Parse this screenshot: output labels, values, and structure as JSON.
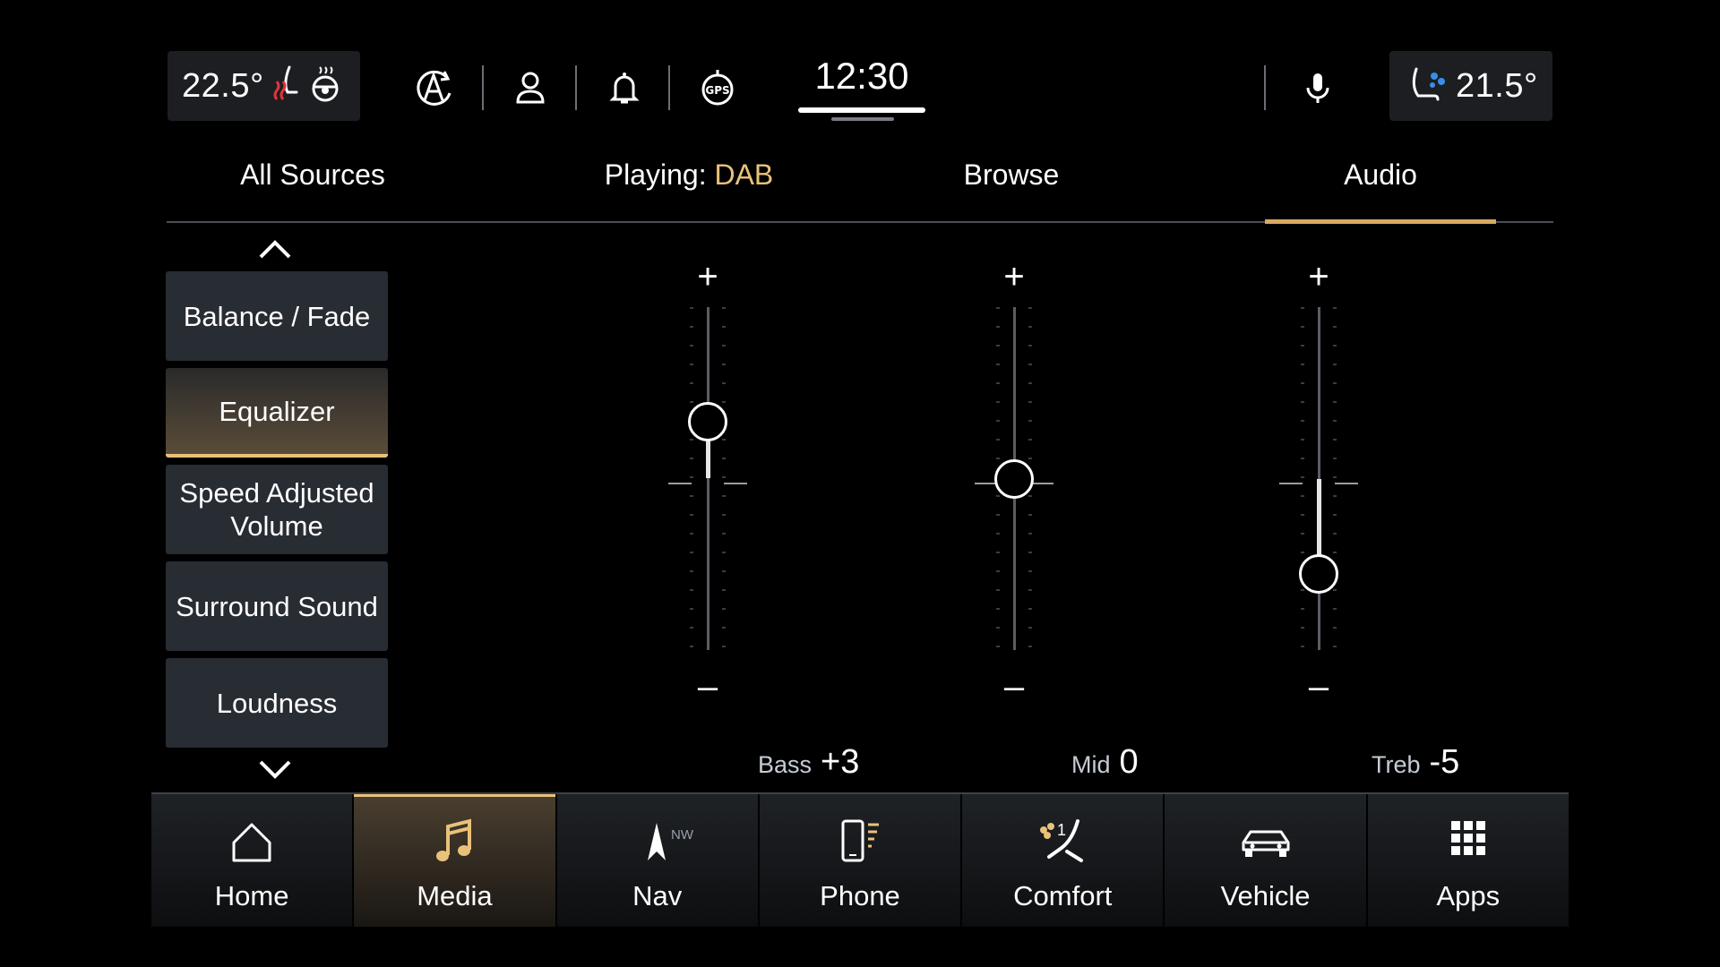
{
  "status": {
    "left_temp": "22.5°",
    "right_temp": "21.5°",
    "clock": "12:30"
  },
  "tabs": [
    {
      "label": "All Sources"
    },
    {
      "label_prefix": "Playing: ",
      "label_source": "DAB"
    },
    {
      "label": "Browse"
    },
    {
      "label": "Audio",
      "active": true
    }
  ],
  "menu": {
    "items": [
      {
        "label": "Balance / Fade"
      },
      {
        "label": "Equalizer",
        "active": true
      },
      {
        "label": "Speed Adjusted Volume"
      },
      {
        "label": "Surround Sound"
      },
      {
        "label": "Loudness"
      }
    ]
  },
  "equalizer": {
    "range": [
      -9,
      9
    ],
    "plus_symbol": "+",
    "minus_symbol": "–",
    "bands": [
      {
        "name": "Bass",
        "value_text": "+3",
        "value": 3
      },
      {
        "name": "Mid",
        "value_text": "0",
        "value": 0
      },
      {
        "name": "Treb",
        "value_text": "-5",
        "value": -5
      }
    ]
  },
  "nav": {
    "nw_badge": "NW",
    "comfort_badge": "1",
    "items": [
      {
        "label": "Home",
        "icon": "home-icon"
      },
      {
        "label": "Media",
        "icon": "music-note-icon",
        "active": true
      },
      {
        "label": "Nav",
        "icon": "navigation-arrow-icon"
      },
      {
        "label": "Phone",
        "icon": "phone-icon"
      },
      {
        "label": "Comfort",
        "icon": "seat-fan-icon"
      },
      {
        "label": "Vehicle",
        "icon": "car-icon"
      },
      {
        "label": "Apps",
        "icon": "apps-grid-icon"
      }
    ]
  },
  "colors": {
    "accent": "#e9c27a",
    "panel": "#282c33"
  }
}
